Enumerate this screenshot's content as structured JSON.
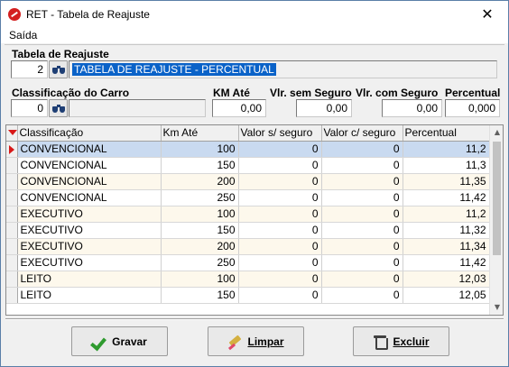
{
  "window": {
    "title": "RET - Tabela de Reajuste",
    "close_glyph": "✕"
  },
  "menu": {
    "items": [
      "Saída"
    ]
  },
  "form": {
    "tabela_label": "Tabela de Reajuste",
    "tabela_code": "2",
    "tabela_desc": "TABELA DE REAJUSTE - PERCENTUAL",
    "classificacao_label": "Classificação do Carro",
    "classificacao_code": "0",
    "classificacao_desc": "",
    "km_label": "KM Até",
    "km_value": "0,00",
    "vlr_sem_label": "Vlr. sem Seguro",
    "vlr_sem_value": "0,00",
    "vlr_com_label": "Vlr. com Seguro",
    "vlr_com_value": "0,00",
    "percentual_label": "Percentual",
    "percentual_value": "0,000"
  },
  "grid": {
    "columns": [
      "Classificação",
      "Km Até",
      "Valor s/ seguro",
      "Valor c/ seguro",
      "Percentual"
    ],
    "rows": [
      [
        "CONVENCIONAL",
        "100",
        "0",
        "0",
        "11,2"
      ],
      [
        "CONVENCIONAL",
        "150",
        "0",
        "0",
        "11,3"
      ],
      [
        "CONVENCIONAL",
        "200",
        "0",
        "0",
        "11,35"
      ],
      [
        "CONVENCIONAL",
        "250",
        "0",
        "0",
        "11,42"
      ],
      [
        "EXECUTIVO",
        "100",
        "0",
        "0",
        "11,2"
      ],
      [
        "EXECUTIVO",
        "150",
        "0",
        "0",
        "11,32"
      ],
      [
        "EXECUTIVO",
        "200",
        "0",
        "0",
        "11,34"
      ],
      [
        "EXECUTIVO",
        "250",
        "0",
        "0",
        "11,42"
      ],
      [
        "LEITO",
        "100",
        "0",
        "0",
        "12,03"
      ],
      [
        "LEITO",
        "150",
        "0",
        "0",
        "12,05"
      ]
    ],
    "selected_row": 0
  },
  "buttons": {
    "gravar": {
      "label": "Gravar",
      "icon": "check-icon"
    },
    "limpar": {
      "label": "Limpar",
      "icon": "eraser-icon"
    },
    "excluir": {
      "label": "Excluir",
      "icon": "trash-icon"
    }
  },
  "colors": {
    "selection": "#0a62c8",
    "current_row": "#c9daf0",
    "alt_row": "#fdf8ec",
    "indicator": "#d81818"
  }
}
